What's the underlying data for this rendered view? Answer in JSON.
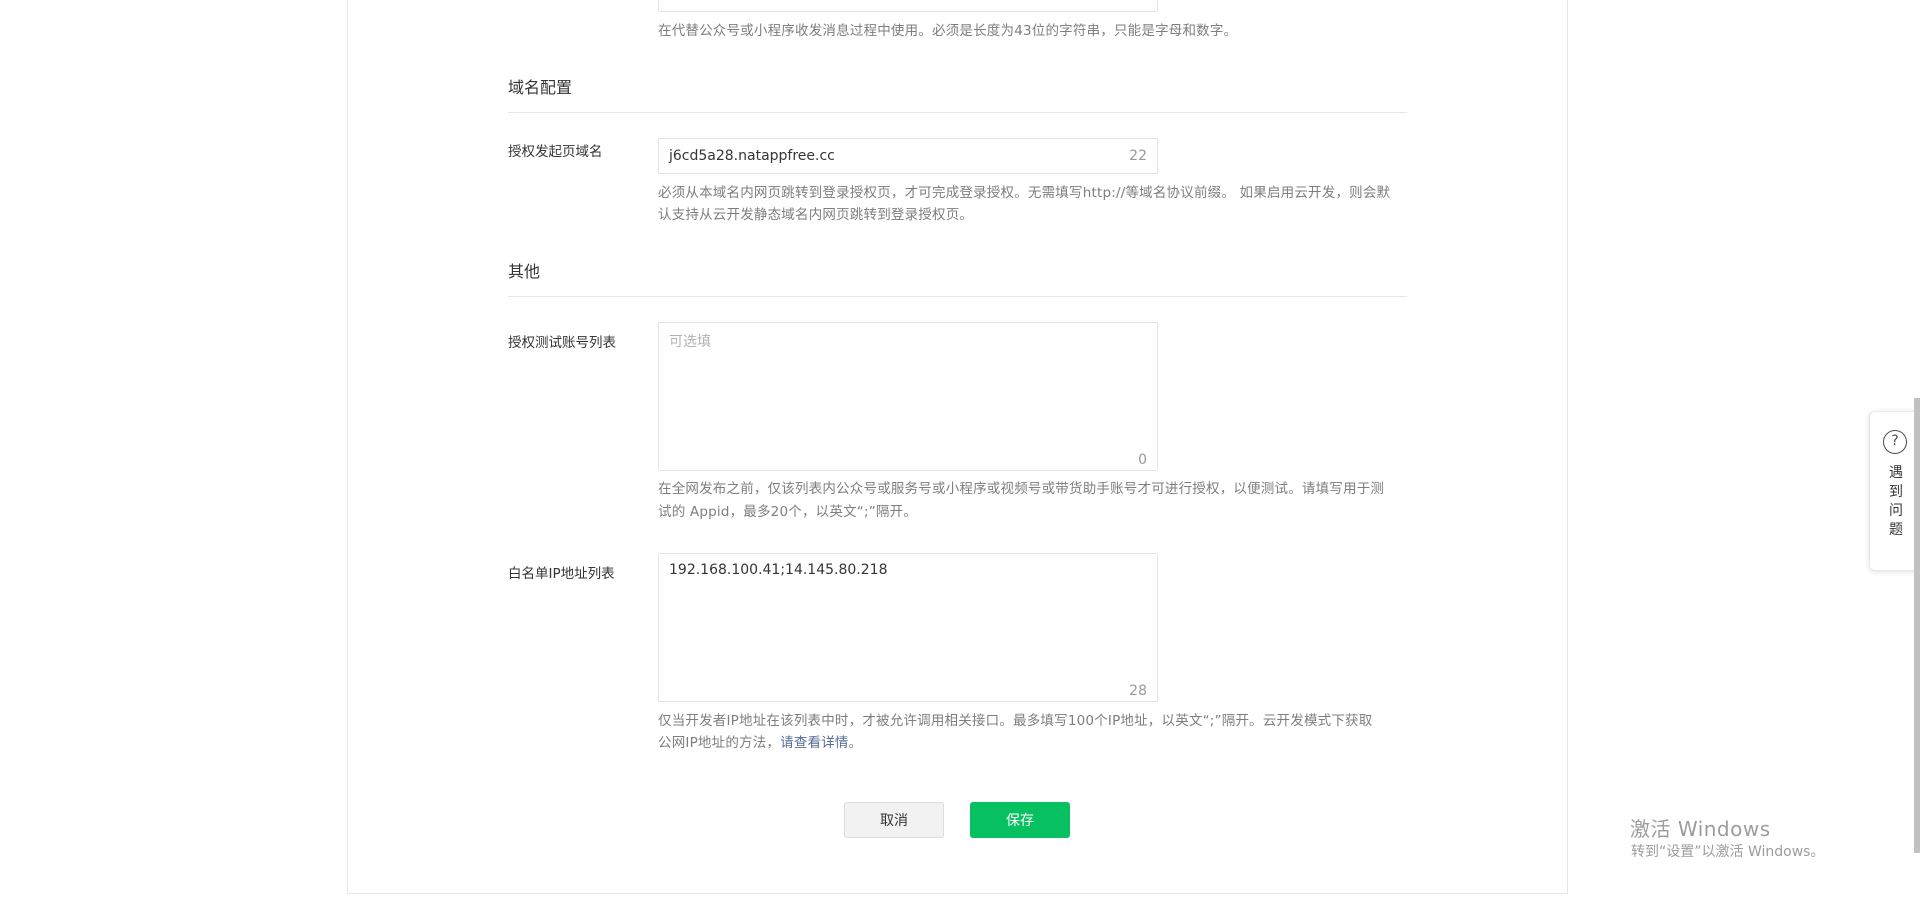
{
  "message_key_section": {
    "tip": "在代替公众号或小程序收发消息过程中使用。必须是长度为43位的字符串，只能是字母和数字。"
  },
  "domain_section": {
    "title": "域名配置",
    "auth_domain": {
      "label": "授权发起页域名",
      "value": "j6cd5a28.natappfree.cc",
      "counter": "22",
      "tip_line1": "必须从本域名内网页跳转到登录授权页，才可完成登录授权。无需填写http://等域名协议前缀。 如果启用云开发，则会默",
      "tip_line2": "认支持从云开发静态域名内网页跳转到登录授权页。"
    }
  },
  "other_section": {
    "title": "其他",
    "test_accounts": {
      "label": "授权测试账号列表",
      "placeholder": "可选填",
      "counter": "0",
      "tip_line1": "在全网发布之前，仅该列表内公众号或服务号或小程序或视频号或带货助手账号才可进行授权，以便测试。请填写用于测",
      "tip_line2": "试的 Appid，最多20个，以英文“;”隔开。"
    },
    "ip_whitelist": {
      "label": "白名单IP地址列表",
      "value": "192.168.100.41;14.145.80.218",
      "counter": "28",
      "tip_line1": "仅当开发者IP地址在该列表中时，才被允许调用相关接口。最多填写100个IP地址，以英文“;”隔开。云开发模式下获取",
      "tip_line2_prefix": "公网IP地址的方法，",
      "tip_line2_link": "请查看详情",
      "tip_line2_suffix": "。"
    }
  },
  "actions": {
    "cancel_label": "取消",
    "save_label": "保存"
  },
  "help_widget": {
    "icon": "question-circle-icon",
    "icon_glyph": "?",
    "label": "遇到问题"
  },
  "watermark": {
    "title": "激活 Windows",
    "subtitle": "转到“设置”以激活 Windows。"
  },
  "colors": {
    "primary_green": "#07c160",
    "link_blue": "#576b95"
  }
}
